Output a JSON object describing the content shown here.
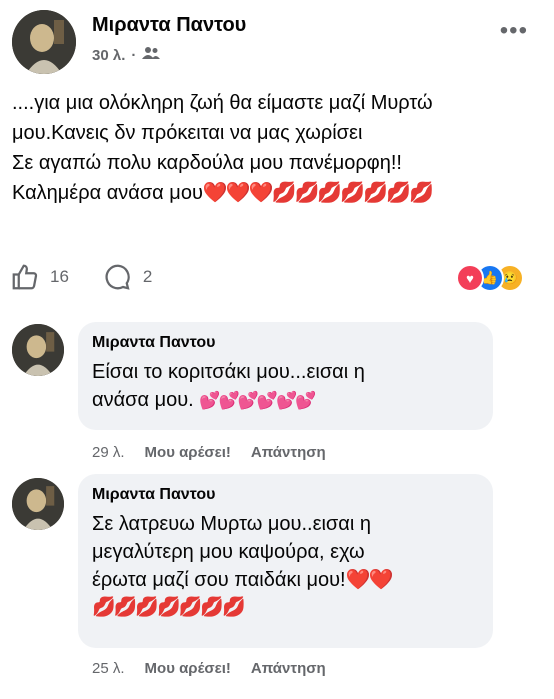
{
  "post": {
    "author": "Μιραντα Παντου",
    "time": "30 λ.",
    "separator": "·",
    "audience_icon": "friends-icon",
    "lines": [
      "....για μια ολόκληρη ζωή θα είμαστε μαζί Μυρτώ",
      "μου.Κανεις δν πρόκειται να μας χωρίσει",
      "Σε αγαπώ πολυ καρδούλα μου πανέμορφη!!",
      "Καλημέρα ανάσα μου"
    ],
    "line4_emojis": "❤️❤️❤️💋💋💋💋💋💋💋",
    "like_count": "16",
    "comment_count": "2",
    "reactions": [
      "love",
      "like",
      "sad"
    ]
  },
  "comments": [
    {
      "author": "Μιραντα Παντου",
      "lines": [
        "Είσαι το κοριτσάκι μου...εισαι η",
        "ανάσα μου."
      ],
      "emojis": "💕💕💕💕💕💕",
      "time": "29 λ.",
      "like_label": "Μου αρέσει!",
      "reply_label": "Απάντηση"
    },
    {
      "author": "Μιραντα Παντου",
      "lines": [
        "Σε λατρευω Μυρτω μου..εισαι η",
        "μεγαλύτερη μου καψούρα, εχω",
        "έρωτα μαζί σου παιδάκι μου!"
      ],
      "line3_emojis": "❤️❤️",
      "emojis": "💋💋💋💋💋💋💋",
      "time": "25 λ.",
      "like_label": "Μου αρέσει!",
      "reply_label": "Απάντηση"
    }
  ],
  "colors": {
    "love": "#f33e58",
    "like": "#1877f2",
    "sad": "#f7b125",
    "muted": "#65676b"
  }
}
